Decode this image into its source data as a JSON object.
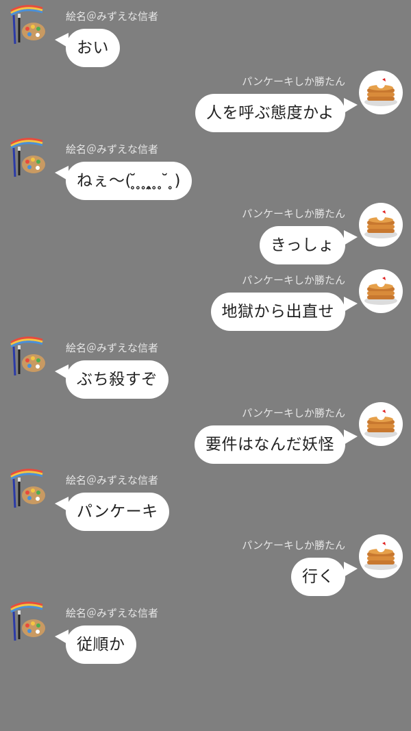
{
  "chat": {
    "messages": [
      {
        "side": "left",
        "sender": "絵名＠みずえな信者",
        "text": "おい",
        "avatar_icon": "paint-palette-icon"
      },
      {
        "side": "right",
        "sender": "パンケーキしか勝たん",
        "text": "人を呼ぶ態度かよ",
        "avatar_icon": "pancake-icon"
      },
      {
        "side": "left",
        "sender": "絵名＠みずえな信者",
        "text": "ねぇ〜( ̥̆ ̥ ̥ ̯̥ ̥ ̥ ̆ ̥)",
        "avatar_icon": "paint-palette-icon"
      },
      {
        "side": "right",
        "sender": "パンケーキしか勝たん",
        "text": "きっしょ",
        "avatar_icon": "pancake-icon"
      },
      {
        "side": "right",
        "sender": "パンケーキしか勝たん",
        "text": "地獄から出直せ",
        "avatar_icon": "pancake-icon"
      },
      {
        "side": "left",
        "sender": "絵名＠みずえな信者",
        "text": "ぶち殺すぞ",
        "avatar_icon": "paint-palette-icon"
      },
      {
        "side": "right",
        "sender": "パンケーキしか勝たん",
        "text": "要件はなんだ妖怪",
        "avatar_icon": "pancake-icon"
      },
      {
        "side": "left",
        "sender": "絵名＠みずえな信者",
        "text": "パンケーキ",
        "avatar_icon": "paint-palette-icon"
      },
      {
        "side": "right",
        "sender": "パンケーキしか勝たん",
        "text": "行く",
        "avatar_icon": "pancake-icon"
      },
      {
        "side": "left",
        "sender": "絵名＠みずえな信者",
        "text": "従順か",
        "avatar_icon": "paint-palette-icon"
      }
    ]
  }
}
